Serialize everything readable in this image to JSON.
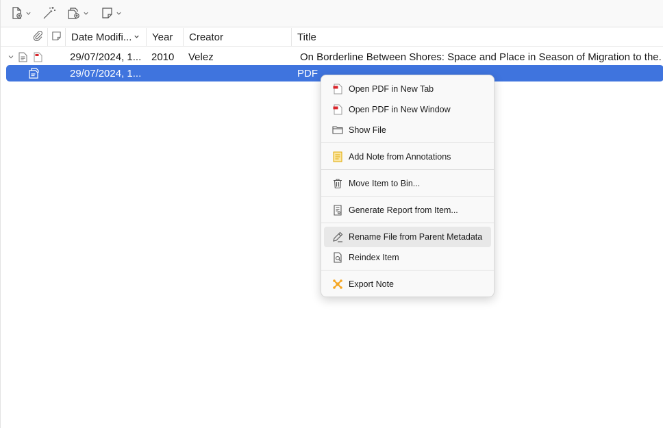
{
  "toolbar": {
    "buttons": [
      {
        "icon": "new-item-icon",
        "has_menu": true
      },
      {
        "icon": "magic-wand-icon",
        "has_menu": false
      },
      {
        "icon": "add-attachment-icon",
        "has_menu": true
      },
      {
        "icon": "new-note-icon",
        "has_menu": true
      }
    ]
  },
  "columns": {
    "attachment_icon": "paperclip-icon",
    "notes_icon": "note-icon",
    "date_modified": "Date Modifi...",
    "year": "Year",
    "creator": "Creator",
    "title": "Title"
  },
  "rows": [
    {
      "expander": "chevron-down-icon",
      "type_icon": "document-icon",
      "attachment_icon": "pdf-icon",
      "date_modified": "29/07/2024, 1...",
      "year": "2010",
      "creator": "Velez",
      "title": "On Borderline Between Shores: Space and Place in Season of Migration to the..."
    },
    {
      "type_icon": "pdf-attachment-icon",
      "date_modified": "29/07/2024, 1...",
      "year": "",
      "creator": "",
      "title": "PDF",
      "selected": true
    }
  ],
  "context_menu": {
    "items": [
      {
        "label": "Open PDF in New Tab",
        "icon": "pdf-icon"
      },
      {
        "label": "Open PDF in New Window",
        "icon": "pdf-icon"
      },
      {
        "label": "Show File",
        "icon": "folder-icon"
      },
      {
        "label": "Add Note from Annotations",
        "icon": "note-annotations-icon"
      },
      {
        "label": "Move Item to Bin...",
        "icon": "trash-icon"
      },
      {
        "label": "Generate Report from Item...",
        "icon": "report-icon"
      },
      {
        "label": "Rename File from Parent Metadata",
        "icon": "rename-icon",
        "hovered": true
      },
      {
        "label": "Reindex Item",
        "icon": "reindex-icon"
      },
      {
        "label": "Export Note",
        "icon": "export-note-icon"
      }
    ]
  },
  "colors": {
    "selection": "#3f74de",
    "pdf_red": "#d9252b",
    "note_yellow": "#f4b400",
    "export_orange": "#f5a623"
  }
}
